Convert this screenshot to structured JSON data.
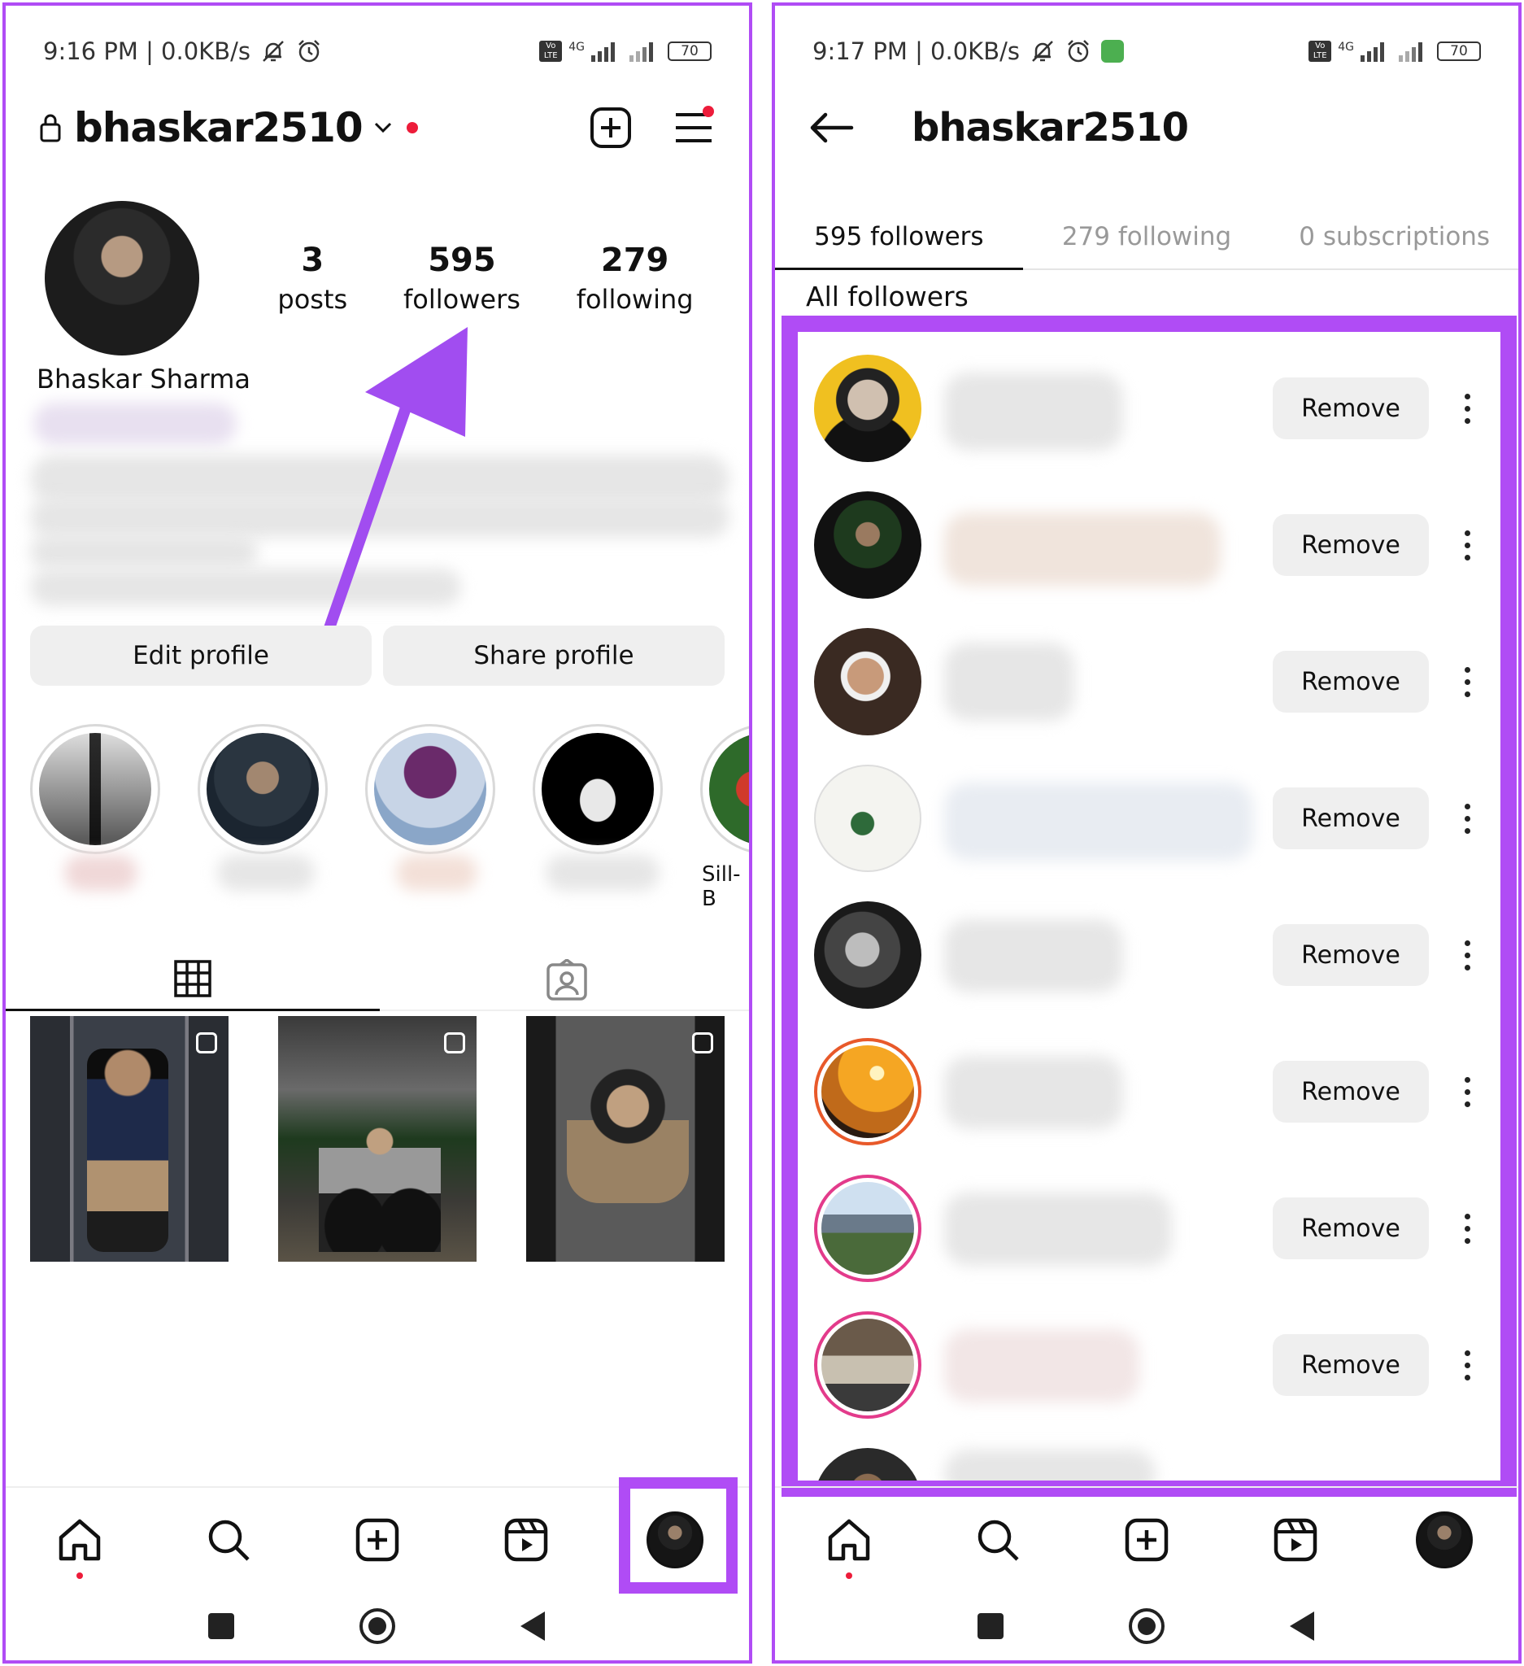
{
  "left": {
    "status": {
      "time": "9:16 PM | 0.0KB/s",
      "net": "4G",
      "battery": "70"
    },
    "header": {
      "username": "bhaskar2510"
    },
    "profile": {
      "display_name": "Bhaskar Sharma",
      "stats": [
        {
          "value": "3",
          "label": "posts"
        },
        {
          "value": "595",
          "label": "followers"
        },
        {
          "value": "279",
          "label": "following"
        }
      ]
    },
    "buttons": {
      "edit": "Edit profile",
      "share": "Share profile"
    },
    "highlight_partial_label": "Sill-B"
  },
  "right": {
    "status": {
      "time": "9:17 PM | 0.0KB/s",
      "net": "4G",
      "battery": "70"
    },
    "header": {
      "username": "bhaskar2510"
    },
    "tabs": [
      "595 followers",
      "279 following",
      "0 subscriptions"
    ],
    "section_title": "All followers",
    "remove_label": "Remove"
  },
  "icons": [
    "lock-icon",
    "chevron-down-icon",
    "new-post-icon",
    "menu-icon",
    "grid-icon",
    "tagged-icon",
    "home-icon",
    "search-icon",
    "create-icon",
    "reels-icon",
    "back-arrow-icon",
    "more-icon"
  ],
  "colors": {
    "annotation": "#b04cf5",
    "notification": "#ed1c3a",
    "button_bg": "#efefef",
    "story_ring": "#e33b8b"
  }
}
